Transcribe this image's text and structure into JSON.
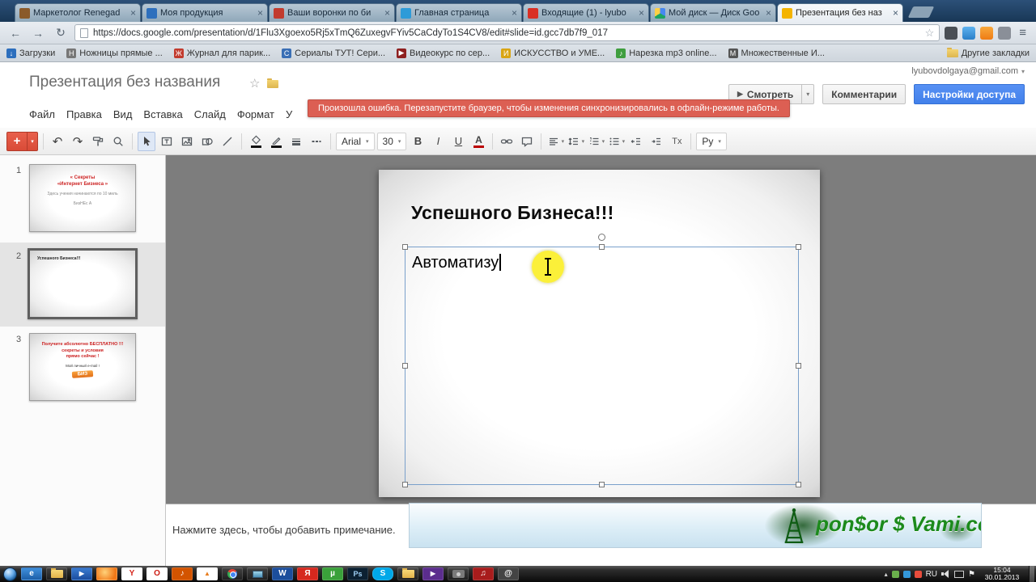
{
  "icons": {
    "back": "←",
    "forward": "→",
    "reload": "↻",
    "star": "☆",
    "menu": "≡",
    "caret": "▾",
    "up": "▴",
    "undo": "↶",
    "redo": "↷",
    "plus": "+",
    "play": "▶",
    "flag": "⚑",
    "close": "×"
  },
  "tabs": [
    {
      "label": "Маркетолог Renegad"
    },
    {
      "label": "Моя продукция"
    },
    {
      "label": "Ваши воронки по би"
    },
    {
      "label": "Главная страница"
    },
    {
      "label": "Входящие (1) - lyubo"
    },
    {
      "label": "Мой диск — Диск Goo"
    },
    {
      "label": "Презентация без наз"
    }
  ],
  "address": {
    "url": "https://docs.google.com/presentation/d/1Flu3Xgoexo5Rj5xTmQ6ZuxegvFYiv5CaCdyTo1S4CV8/edit#slide=id.gcc7db7f9_017"
  },
  "bookmarks": [
    {
      "label": "Загрузки",
      "g": "↓"
    },
    {
      "label": "Ножницы прямые ...",
      "g": "Н"
    },
    {
      "label": "Журнал для парик...",
      "g": "Ж"
    },
    {
      "label": "Сериалы ТУТ! Сери...",
      "g": "С"
    },
    {
      "label": "Видеокурс по сер...",
      "g": "▶"
    },
    {
      "label": "ИСКУССТВО и УМЕ...",
      "g": "И"
    },
    {
      "label": "Нарезка mp3 online...",
      "g": "♪"
    },
    {
      "label": "Множественные И...",
      "g": "М"
    },
    {
      "label": "Другие закладки",
      "g": ""
    }
  ],
  "docs": {
    "title": "Презентация без названия",
    "account": "lyubovdolgaya@gmail.com",
    "error": "Произошла ошибка. Перезапустите браузер, чтобы изменения синхронизировались в офлайн-режиме работы.",
    "menus": [
      {
        "label": "Файл"
      },
      {
        "label": "Правка"
      },
      {
        "label": "Вид"
      },
      {
        "label": "Вставка"
      },
      {
        "label": "Слайд"
      },
      {
        "label": "Формат"
      },
      {
        "label": "У"
      }
    ],
    "watch": "Смотреть",
    "comments": "Комментарии",
    "share": "Настройки доступа",
    "font": "Arial",
    "size": "30",
    "bold": "B",
    "italic": "I",
    "underline": "U",
    "color_a": "A",
    "clear": "Tx",
    "input": "Ру"
  },
  "filmstrip": [
    {
      "num": "1",
      "r1": "« Секреты",
      "r2": "«Интернет Бизнеса »",
      "s1": "Здесь учения начинаются по 10 миль",
      "s2": "БизНЕс А"
    },
    {
      "num": "2",
      "t1": "Успешного Бизнеса!!!"
    },
    {
      "num": "3",
      "r1": "Получите абсолютно БЕСПЛАТНО !!!",
      "r2": "секреты и условия",
      "r3": "прямо сейчас !",
      "b1": "Мой личный e-mail !",
      "logo": "БИЗ"
    }
  ],
  "slide": {
    "title": "Успешного Бизнеса!!!",
    "body": "Автоматизу"
  },
  "notes": "Нажмите здесь, чтобы добавить примечание.",
  "ad": {
    "text": "pon$or $ Vami.com"
  },
  "taskbar": {
    "icons": [
      {
        "g": "e"
      },
      {
        "g": ""
      },
      {
        "g": "▶"
      },
      {
        "g": ""
      },
      {
        "g": "Y"
      },
      {
        "g": "O"
      },
      {
        "g": "♪"
      },
      {
        "g": "▲"
      },
      {
        "g": ""
      },
      {
        "g": ""
      },
      {
        "g": "W"
      },
      {
        "g": "Я"
      },
      {
        "g": "µ"
      },
      {
        "g": "Ps"
      },
      {
        "g": "S"
      },
      {
        "g": ""
      },
      {
        "g": "▶"
      },
      {
        "g": ""
      },
      {
        "g": "♫"
      },
      {
        "g": "@"
      }
    ],
    "lang": "RU",
    "time": "15:04",
    "date": "30.01.2013"
  }
}
